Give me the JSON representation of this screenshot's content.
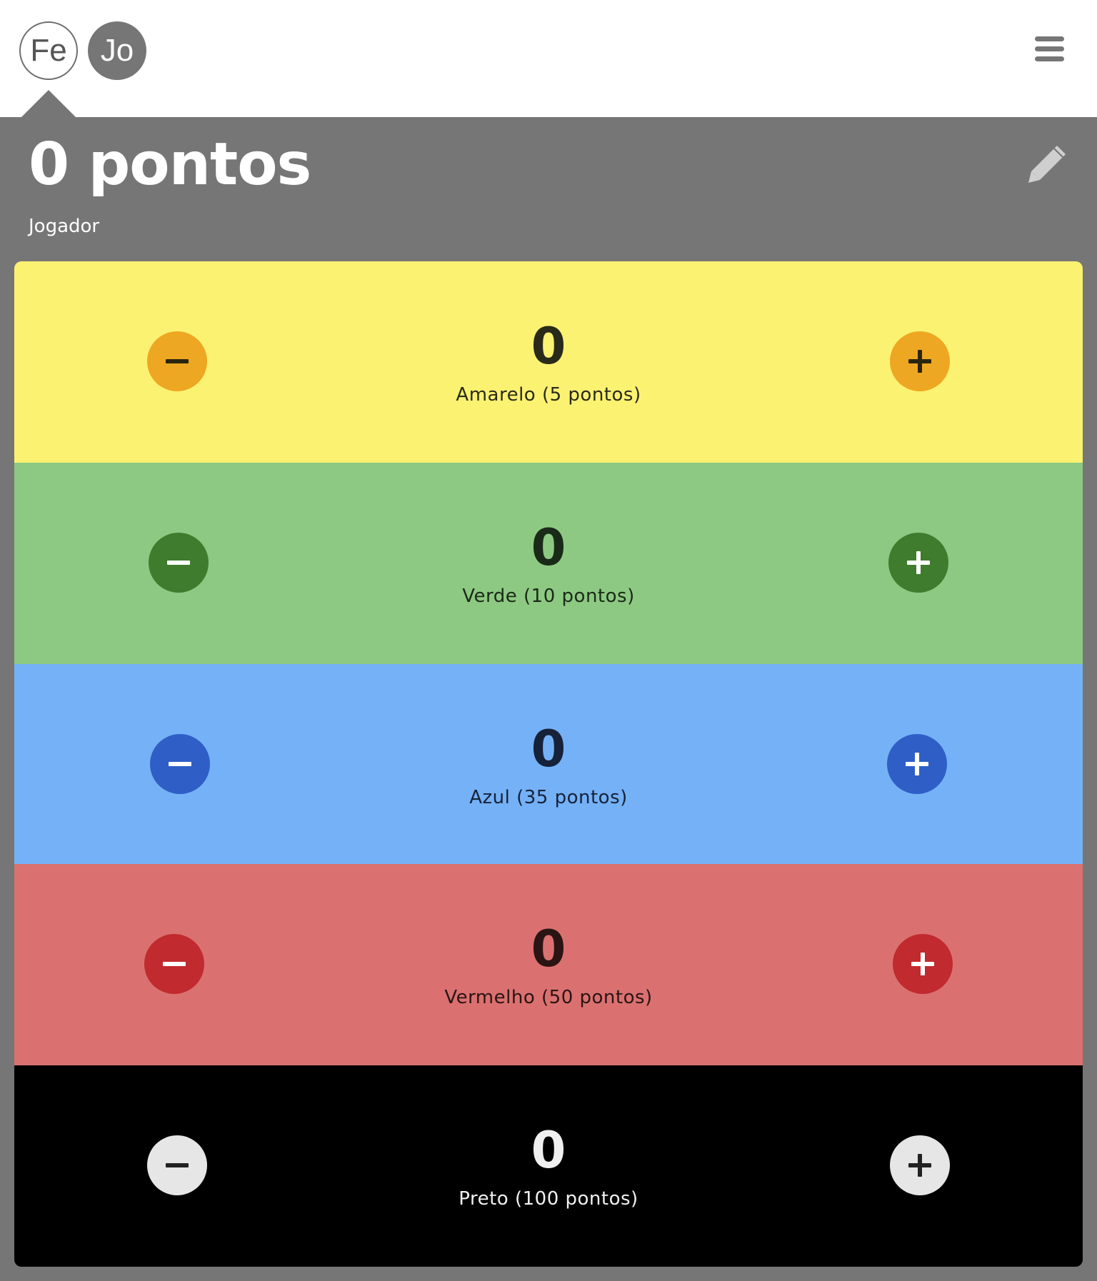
{
  "players": [
    {
      "initials": "Fe",
      "active": false
    },
    {
      "initials": "Jo",
      "active": true
    }
  ],
  "header": {
    "total": "0 pontos",
    "player_name": "Jogador"
  },
  "icons": {
    "menu": "hamburger-menu-icon",
    "edit": "pencil-icon",
    "minus": "minus-icon",
    "plus": "plus-icon"
  },
  "rows": [
    {
      "count": "0",
      "label": "Amarelo (5 pontos)",
      "bg": "#fbf272",
      "btn": "#eea722",
      "sign": "#2a250e",
      "text": "#2a2a1a"
    },
    {
      "count": "0",
      "label": "Verde (10 pontos)",
      "bg": "#8dc982",
      "btn": "#3f7c2d",
      "sign": "#ffffff",
      "text": "#1a2a18"
    },
    {
      "count": "0",
      "label": "Azul (35 pontos)",
      "bg": "#75b1f6",
      "btn": "#2f5ec7",
      "sign": "#ffffff",
      "text": "#16223a"
    },
    {
      "count": "0",
      "label": "Vermelho (50 pontos)",
      "bg": "#da7170",
      "btn": "#c12a2e",
      "sign": "#ffffff",
      "text": "#2a1414"
    },
    {
      "count": "0",
      "label": "Preto (100 pontos)",
      "bg": "#000000",
      "btn": "#e6e6e6",
      "sign": "#222222",
      "text": "#f0f0f0"
    }
  ]
}
